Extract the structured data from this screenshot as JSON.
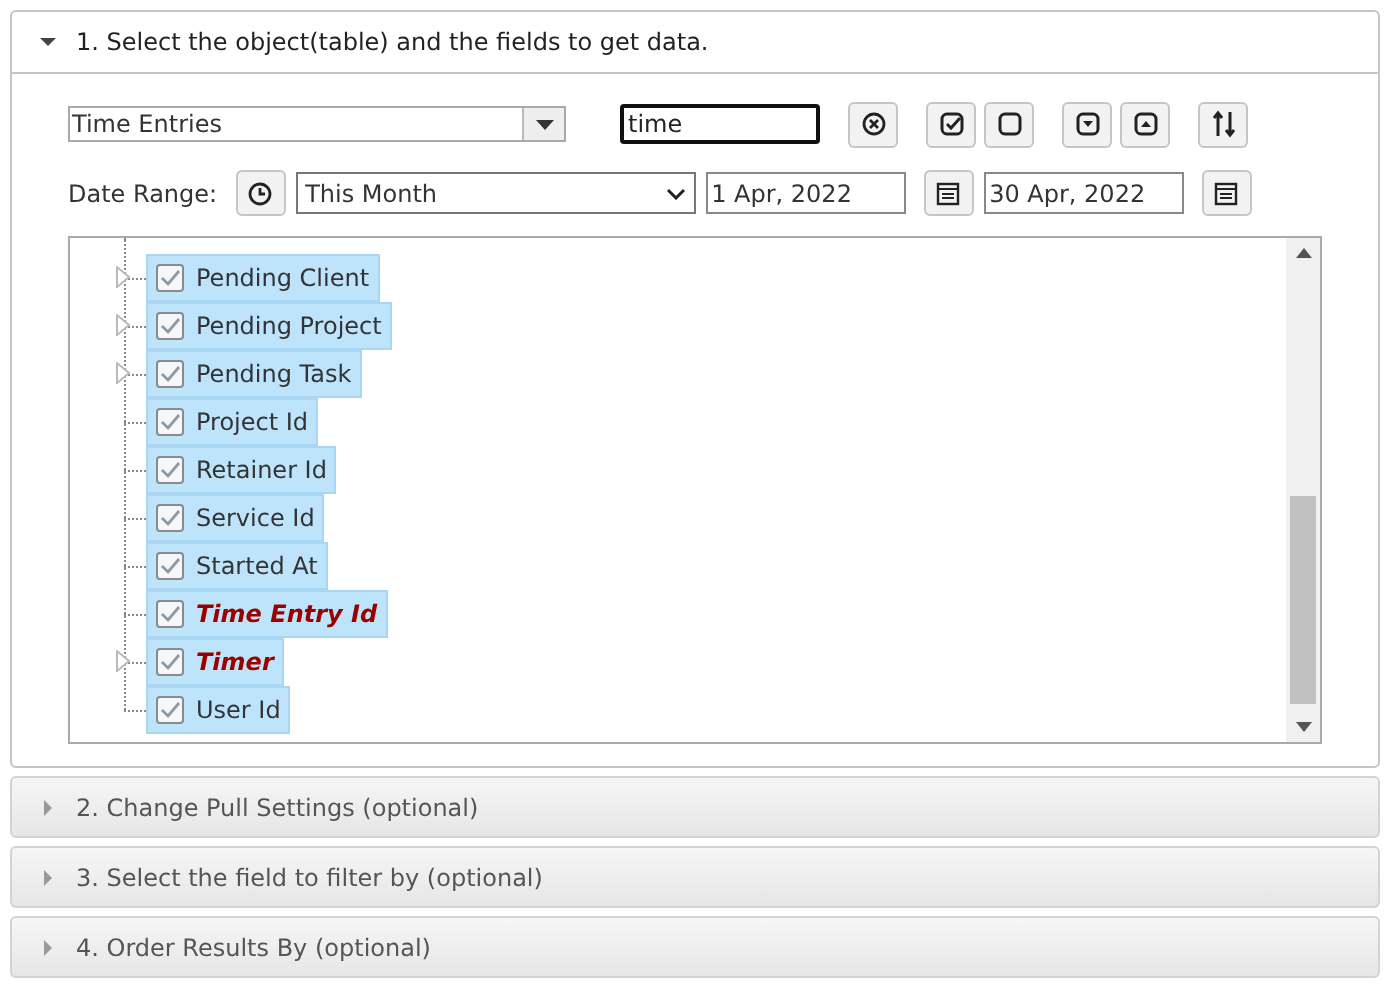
{
  "sections": [
    {
      "title": "1. Select the object(table) and the fields to get data.",
      "expanded": true
    },
    {
      "title": "2. Change Pull Settings (optional)",
      "expanded": false
    },
    {
      "title": "3. Select the field to filter by (optional)",
      "expanded": false
    },
    {
      "title": "4. Order Results By (optional)",
      "expanded": false
    }
  ],
  "object_select": {
    "value": "Time Entries"
  },
  "search": {
    "value": "time"
  },
  "date_range": {
    "label": "Date Range:",
    "preset": "This Month",
    "from": "1 Apr, 2022",
    "to": "30 Apr, 2022"
  },
  "tree": [
    {
      "label": "Pending Client",
      "expandable": true,
      "checked": true,
      "selected": true,
      "emphasized": false
    },
    {
      "label": "Pending Project",
      "expandable": true,
      "checked": true,
      "selected": true,
      "emphasized": false
    },
    {
      "label": "Pending Task",
      "expandable": true,
      "checked": true,
      "selected": true,
      "emphasized": false
    },
    {
      "label": "Project Id",
      "expandable": false,
      "checked": true,
      "selected": true,
      "emphasized": false
    },
    {
      "label": "Retainer Id",
      "expandable": false,
      "checked": true,
      "selected": true,
      "emphasized": false
    },
    {
      "label": "Service Id",
      "expandable": false,
      "checked": true,
      "selected": true,
      "emphasized": false
    },
    {
      "label": "Started At",
      "expandable": false,
      "checked": true,
      "selected": true,
      "emphasized": false
    },
    {
      "label": "Time Entry Id",
      "expandable": false,
      "checked": true,
      "selected": true,
      "emphasized": true
    },
    {
      "label": "Timer",
      "expandable": true,
      "checked": true,
      "selected": true,
      "emphasized": true
    },
    {
      "label": "User Id",
      "expandable": false,
      "checked": true,
      "selected": true,
      "emphasized": false
    }
  ]
}
